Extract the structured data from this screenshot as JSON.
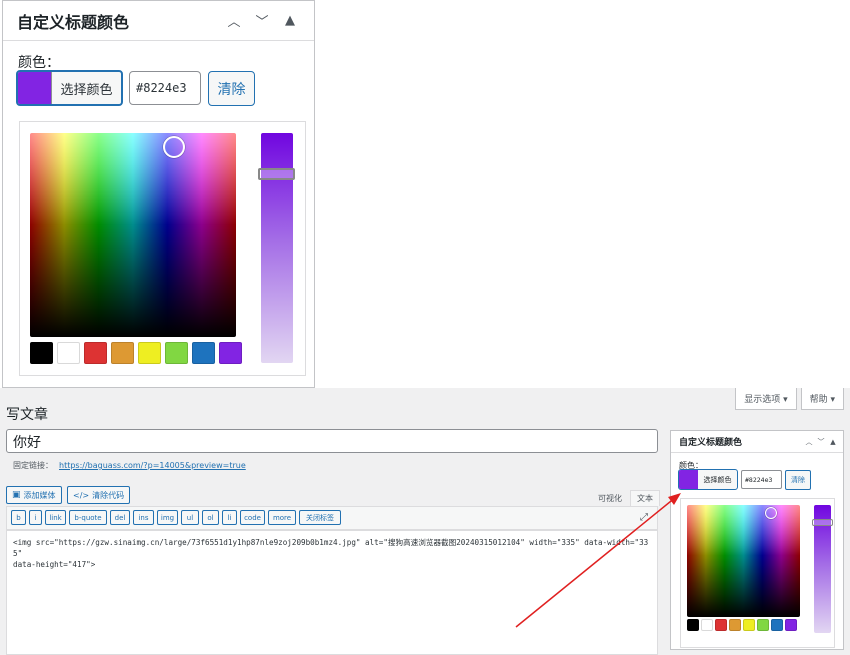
{
  "zoomed_box": {
    "title": "自定义标题颜色",
    "label": "颜色：",
    "pick_button": "选择颜色",
    "hex_value": "#8224e3",
    "clear_button": "清除"
  },
  "colors": {
    "selected": "#8224e3",
    "palette": [
      "#000000",
      "#ffffff",
      "#dd3333",
      "#dd9933",
      "#eeee22",
      "#81d742",
      "#1e73be",
      "#8224e3"
    ],
    "accent": "#2271b1"
  },
  "editor": {
    "screen_options": "显示选项 ▾",
    "help": "帮助 ▾",
    "page_title": "写文章",
    "post_title": "你好",
    "permalink_label": "固定链接：",
    "permalink_url": "https://baguass.com/?p=14005&preview=true",
    "add_media": "添加媒体",
    "clear_code": "清除代码",
    "tab_visual": "可视化",
    "tab_text": "文本",
    "quicktags": [
      "b",
      "i",
      "link",
      "b-quote",
      "del",
      "ins",
      "img",
      "ul",
      "ol",
      "li",
      "code",
      "more",
      "关闭标签"
    ],
    "code_line1": "<img src=\"https://gzw.sinaimg.cn/large/73f6551d1y1hp87nle9zoj209b0b1mz4.jpg\" alt=\"搜狗高速浏览器截图20240315012104\" width=\"335\" data-width=\"335\"",
    "code_line2": "data-height=\"417\">"
  },
  "side_box": {
    "title": "自定义标题颜色",
    "label": "颜色：",
    "pick_button": "选择颜色",
    "hex_value": "#8224e3",
    "clear_button": "清除"
  },
  "annotation": {
    "color": "#e02020"
  }
}
